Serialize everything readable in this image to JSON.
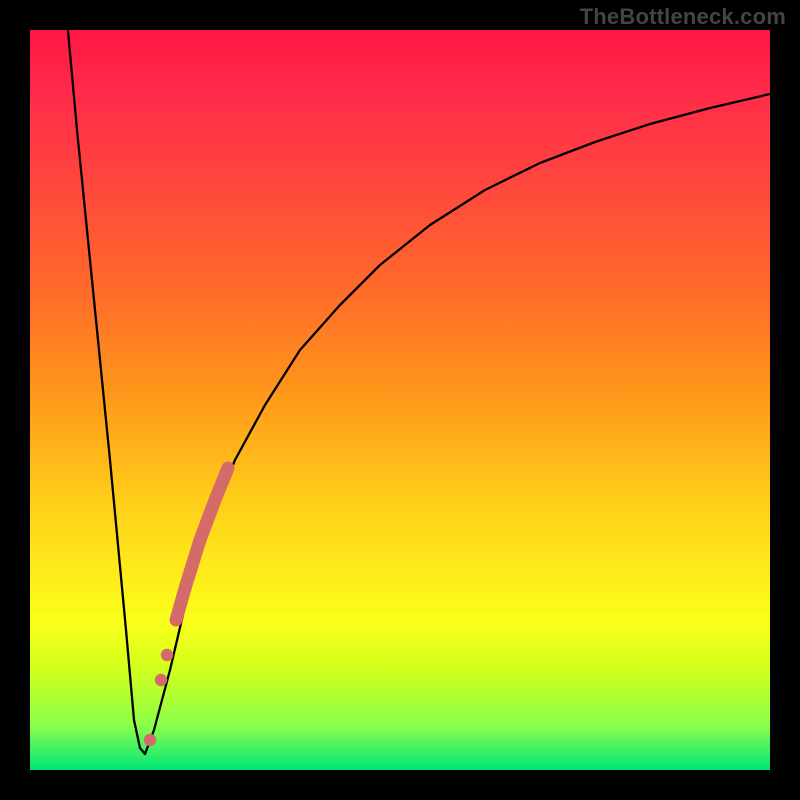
{
  "watermark": "TheBottleneck.com",
  "colors": {
    "frame_bg": "#000000",
    "watermark_text": "#444444",
    "curve_stroke": "#000000",
    "marker_fill": "#d46a6a",
    "gradient_stops": [
      "#ff1744",
      "#ff2a4a",
      "#ff4040",
      "#ff6a2a",
      "#ff9a1a",
      "#ffc81a",
      "#ffe81a",
      "#f9ff1a",
      "#d4ff1a",
      "#8aff4a",
      "#00e676"
    ]
  },
  "chart_data": {
    "type": "line",
    "title": "",
    "xlabel": "",
    "ylabel": "",
    "xlim": [
      0,
      100
    ],
    "ylim": [
      0,
      100
    ],
    "series": [
      {
        "name": "bottleneck-curve",
        "x": [
          4,
          6,
          8,
          10,
          12,
          13,
          14,
          15,
          16,
          18,
          20,
          22,
          25,
          28,
          32,
          36,
          40,
          45,
          50,
          55,
          60,
          65,
          70,
          75,
          80,
          85,
          90,
          95,
          100
        ],
        "y": [
          100,
          78,
          56,
          34,
          14,
          6,
          2,
          4,
          10,
          22,
          34,
          44,
          53,
          60,
          67,
          72,
          76,
          80,
          83,
          85.5,
          87.5,
          89,
          90.3,
          91.3,
          92.2,
          93,
          93.6,
          94.2,
          94.7
        ]
      }
    ],
    "markers": [
      {
        "name": "highlight-segment-upper",
        "x": [
          18.5,
          23.0
        ],
        "y": [
          27,
          46
        ]
      },
      {
        "name": "highlight-dot-a",
        "x": 16.5,
        "y": 14
      },
      {
        "name": "highlight-dot-b",
        "x": 17.2,
        "y": 18
      },
      {
        "name": "highlight-dot-c",
        "x": 15.0,
        "y": 5
      }
    ]
  }
}
